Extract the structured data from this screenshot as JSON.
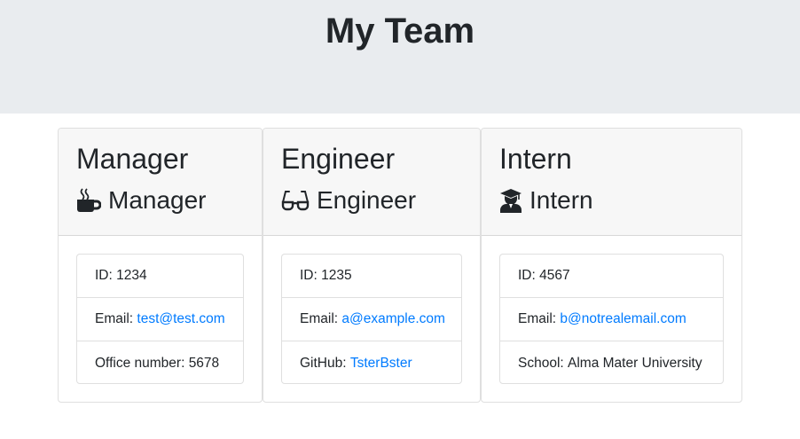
{
  "header": {
    "title": "My Team"
  },
  "cards": [
    {
      "name": "Manager",
      "role": "Manager",
      "role_icon": "mug-icon",
      "id_label": "ID: ",
      "id": "1234",
      "email_label": "Email: ",
      "email": "test@test.com",
      "extra_label": "Office number: ",
      "extra_value": "5678"
    },
    {
      "name": "Engineer",
      "role": "Engineer",
      "role_icon": "glasses-icon",
      "id_label": "ID: ",
      "id": "1235",
      "email_label": "Email: ",
      "email": "a@example.com",
      "extra_label": "GitHub: ",
      "extra_value": "TsterBster"
    },
    {
      "name": "Intern",
      "role": "Intern",
      "role_icon": "graduate-icon",
      "id_label": "ID: ",
      "id": "4567",
      "email_label": "Email: ",
      "email": "b@notrealemail.com",
      "extra_label": "School: ",
      "extra_value": "Alma Mater University"
    }
  ],
  "colors": {
    "link": "#007bff",
    "header_bg": "#e9ecef",
    "card_header_bg": "#f7f7f7"
  }
}
